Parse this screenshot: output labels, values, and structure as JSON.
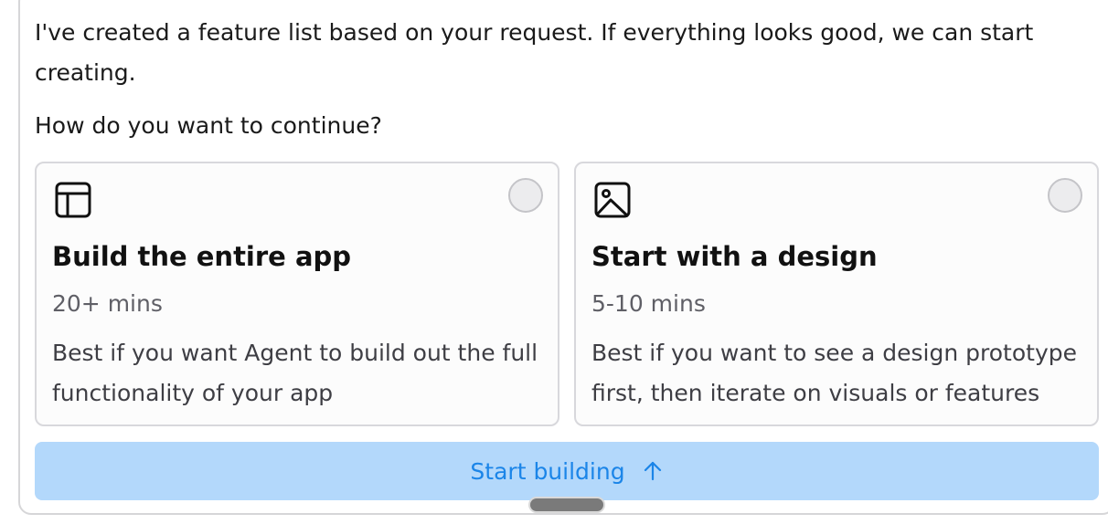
{
  "message": {
    "intro": "I've created a feature list based on your request. If everything looks good, we can start creating.",
    "question": "How do you want to continue?"
  },
  "options": [
    {
      "icon": "layout-icon",
      "title": "Build the entire app",
      "time": "20+ mins",
      "description": "Best if you want Agent to build out the full functionality of your app",
      "selected": false
    },
    {
      "icon": "image-icon",
      "title": "Start with a design",
      "time": "5-10 mins",
      "description": "Best if you want to see a design prototype first, then iterate on visuals or features",
      "selected": false
    }
  ],
  "action": {
    "label": "Start building",
    "icon": "arrow-up-icon",
    "color": "#1b85e8",
    "background": "#b3d8fb"
  }
}
